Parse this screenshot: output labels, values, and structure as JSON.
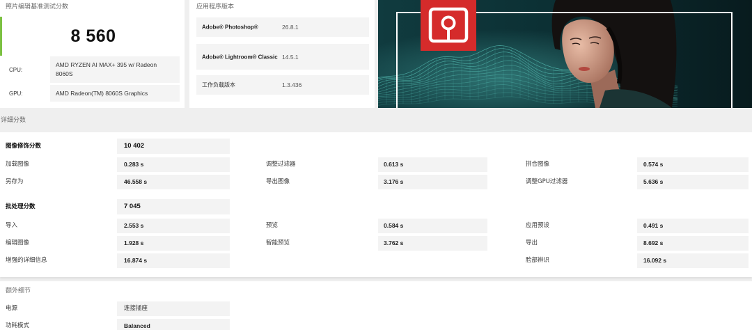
{
  "theme": {
    "accent_green": "#7cc142",
    "brand_red": "#d52b2b"
  },
  "score_card": {
    "title": "照片编辑基准测试分数",
    "score": "8 560",
    "cpu_label": "CPU:",
    "cpu_value": "AMD RYZEN AI MAX+ 395 w/ Radeon 8060S",
    "gpu_label": "GPU:",
    "gpu_value": "AMD Radeon(TM) 8060S Graphics"
  },
  "versions_card": {
    "title": "应用程序版本",
    "rows": [
      {
        "label": "Adobe® Photoshop®",
        "value": "26.8.1"
      },
      {
        "label": "Adobe® Lightroom® Classic",
        "value": "14.5.1"
      },
      {
        "label": "工作负载版本",
        "value": "1.3.436"
      }
    ]
  },
  "hero": {
    "logo_icon": "photo-editing-logo-icon"
  },
  "detailed": {
    "title": "详细分数",
    "image_retouching": {
      "label": "图像修饰分数",
      "score": "10 402",
      "rows": [
        {
          "c1": {
            "label": "加载图像",
            "value": "0.283 s"
          },
          "c2": {
            "label": "调整过滤器",
            "value": "0.613 s"
          },
          "c3": {
            "label": "拼合图像",
            "value": "0.574 s"
          }
        },
        {
          "c1": {
            "label": "另存为",
            "value": "46.558 s"
          },
          "c2": {
            "label": "导出图像",
            "value": "3.176 s"
          },
          "c3": {
            "label": "调整GPU过滤器",
            "value": "5.636 s"
          }
        }
      ]
    },
    "batch_processing": {
      "label": "批处理分数",
      "score": "7 045",
      "rows": [
        {
          "c1": {
            "label": "导入",
            "value": "2.553 s"
          },
          "c2": {
            "label": "预览",
            "value": "0.584 s"
          },
          "c3": {
            "label": "应用预设",
            "value": "0.491 s"
          }
        },
        {
          "c1": {
            "label": "编辑图像",
            "value": "1.928 s"
          },
          "c2": {
            "label": "智能预览",
            "value": "3.762 s"
          },
          "c3": {
            "label": "导出",
            "value": "8.692 s"
          }
        },
        {
          "c1": {
            "label": "增强的详细信息",
            "value": "16.874 s"
          },
          "c3": {
            "label": "脸部辨识",
            "value": "16.092 s"
          }
        }
      ]
    }
  },
  "extra": {
    "title": "额外细节",
    "rows": [
      {
        "label": "电源",
        "value": "连接插座"
      },
      {
        "label": "功耗模式",
        "value": "Balanced"
      }
    ]
  }
}
